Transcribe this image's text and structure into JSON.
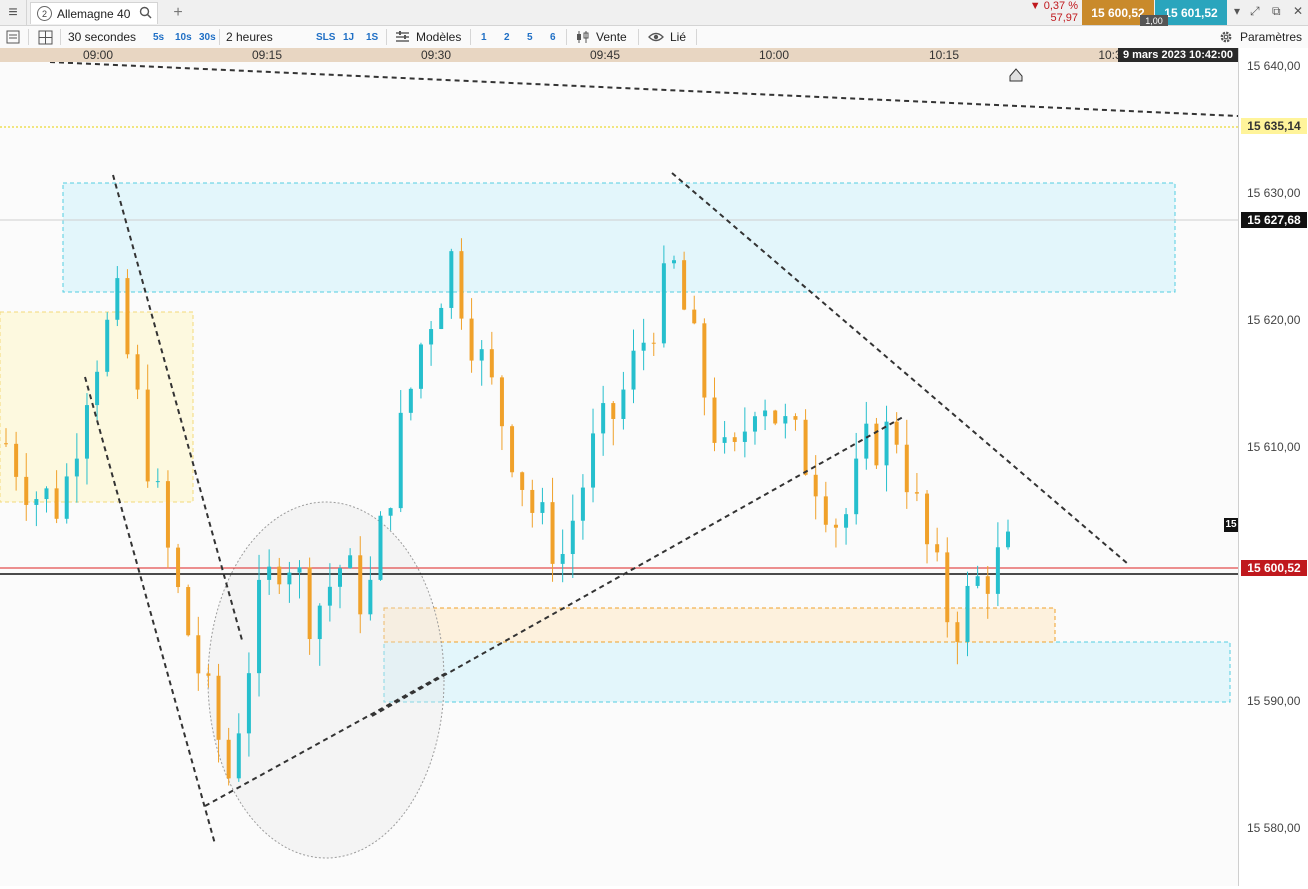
{
  "tabbar": {
    "menu_icon": "hamburger-icon",
    "tab_number": "2",
    "tab_title": "Allemagne 40",
    "add_tab": "+",
    "change_pct": "▼ 0,37 %",
    "change_abs": "57,97",
    "sell_price": "15 600,52",
    "buy_price": "15 601,52",
    "spread": "1,00"
  },
  "toolbar": {
    "interval": "30 secondes",
    "interval_options": [
      "5s",
      "10s",
      "30s"
    ],
    "duration": "2 heures",
    "duration_options": [
      "SLS",
      "1J",
      "1S"
    ],
    "templates_label": "Modèles",
    "template_slots": [
      "1",
      "2",
      "5",
      "6"
    ],
    "sell_label": "Vente",
    "linked_label": "Lié",
    "settings_label": "Paramètres"
  },
  "time_axis": {
    "labels": [
      "09:00",
      "09:15",
      "09:30",
      "09:45",
      "10:00",
      "10:15",
      "10:3"
    ],
    "current": "9 mars 2023 10:42:00"
  },
  "price_axis": {
    "labels": [
      "15 640,00",
      "15 630,00",
      "15 620,00",
      "15 610,00",
      "15 590,00",
      "15 580,00"
    ],
    "tag_high": "15 635,14",
    "tag_ref": "15 627,68",
    "tag_last": "15 600,52",
    "tag_cut": "15"
  },
  "colors": {
    "up": "#26bfcd",
    "down": "#f0a12a",
    "last_price": "#c0181d",
    "high_line": "#e7d100",
    "zone_blue": "#e3f6fb",
    "zone_yellow": "#fdf9df"
  },
  "chart_data": {
    "type": "candlestick",
    "y_range": [
      15575,
      15642
    ],
    "x_labels": [
      "09:00",
      "09:15",
      "09:30",
      "09:45",
      "10:00",
      "10:15",
      "10:3"
    ],
    "candle_count": 100,
    "ohlc_anchor_closes": [
      15611,
      15607,
      15606,
      15617,
      15622,
      15611,
      15600,
      15592,
      15584,
      15597,
      15603,
      15597,
      15601,
      15598,
      15610,
      15620,
      15626,
      15618,
      15612,
      15605,
      15602,
      15610,
      15614,
      15620,
      15625,
      15616,
      15608,
      15616,
      15612,
      15609,
      15604,
      15611,
      15612,
      15603,
      15596,
      15600,
      15602
    ],
    "last_price": 15600.52,
    "high_marker": 15635.14,
    "reference_level": 15627.68
  }
}
